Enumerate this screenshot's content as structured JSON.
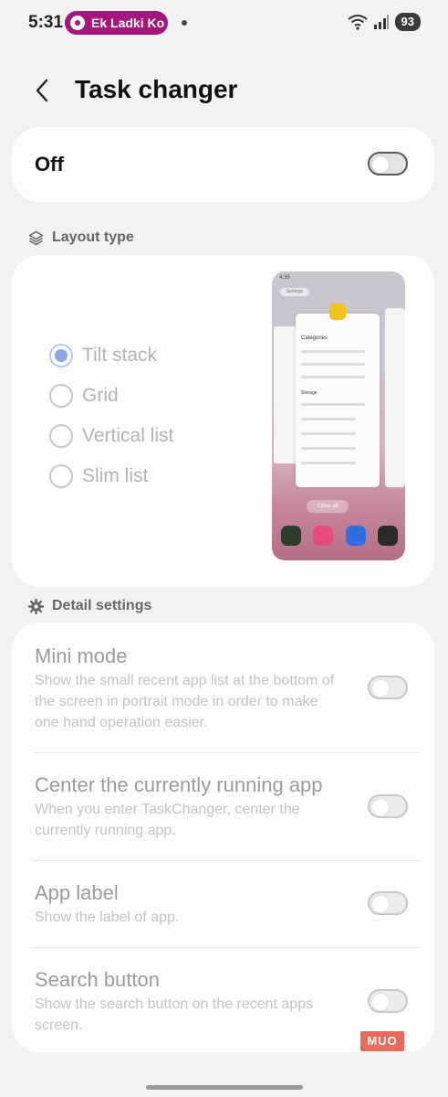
{
  "status_bar": {
    "time": "5:31",
    "media_text": "Ek Ladki Ko",
    "battery": "93"
  },
  "header": {
    "title": "Task changer"
  },
  "master": {
    "label": "Off",
    "enabled": false
  },
  "layout_section": {
    "heading": "Layout type",
    "options": [
      {
        "label": "Tilt stack",
        "selected": true
      },
      {
        "label": "Grid",
        "selected": false
      },
      {
        "label": "Vertical list",
        "selected": false
      },
      {
        "label": "Slim list",
        "selected": false
      }
    ],
    "preview": {
      "time": "4:35",
      "search": "Settings",
      "category": "Categories",
      "storage": "Storage",
      "clear_all": "Close all"
    }
  },
  "detail_section": {
    "heading": "Detail settings",
    "settings": [
      {
        "title": "Mini mode",
        "desc": "Show the small recent app list at the bottom of the screen in portrait mode in order to make one hand operation easier.",
        "enabled": false
      },
      {
        "title": "Center the currently running app",
        "desc": "When you enter TaskChanger, center the currently running app.",
        "enabled": false
      },
      {
        "title": "App label",
        "desc": "Show the label of app.",
        "enabled": false
      },
      {
        "title": "Search button",
        "desc": "Show the search button on the recent apps screen.",
        "enabled": false
      }
    ]
  },
  "watermark": "MUO",
  "colors": {
    "background": "#f2f2f4",
    "card": "#fdfdfd",
    "media_pill": "#a3167a",
    "radio_selected": "#8aa8e4"
  }
}
